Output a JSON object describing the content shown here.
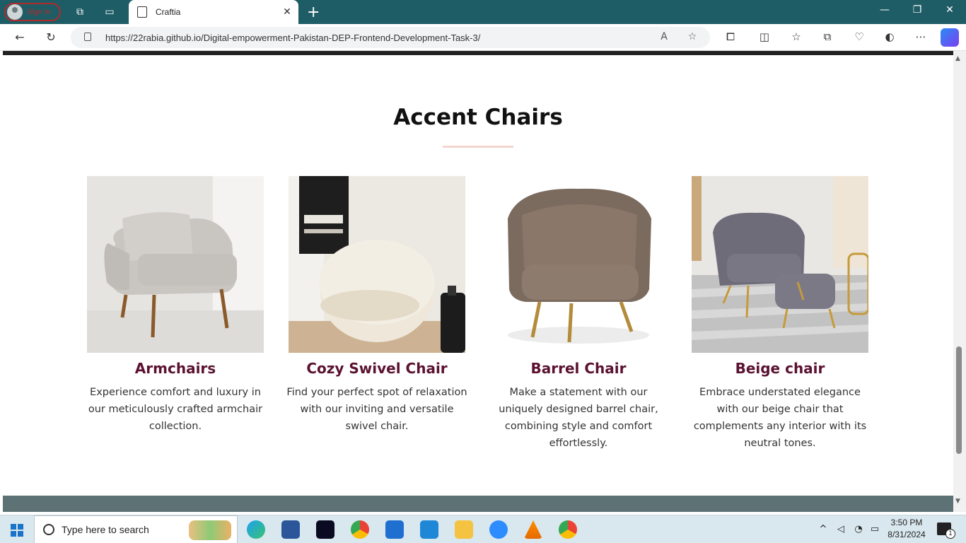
{
  "browser": {
    "signin_label": "Sign in",
    "tab_title": "Craftia",
    "url": "https://22rabia.github.io/Digital-empowerment-Pakistan-DEP-Frontend-Development-Task-3/"
  },
  "section": {
    "heading": "Accent Chairs",
    "accent_color": "#f3d6d0",
    "title_color": "#5a1230",
    "cards": [
      {
        "title": "Armchairs",
        "description": "Experience comfort and luxury in our meticulously crafted armchair collection."
      },
      {
        "title": "Cozy Swivel Chair",
        "description": "Find your perfect spot of relaxation with our inviting and versatile swivel chair."
      },
      {
        "title": "Barrel Chair",
        "description": "Make a statement with our uniquely designed barrel chair, combining style and comfort effortlessly."
      },
      {
        "title": "Beige chair",
        "description": "Embrace understated elegance with our beige chair that complements any interior with its neutral tones."
      }
    ]
  },
  "taskbar": {
    "search_placeholder": "Type here to search",
    "time": "3:50 PM",
    "date": "8/31/2024",
    "notification_count": "1"
  }
}
